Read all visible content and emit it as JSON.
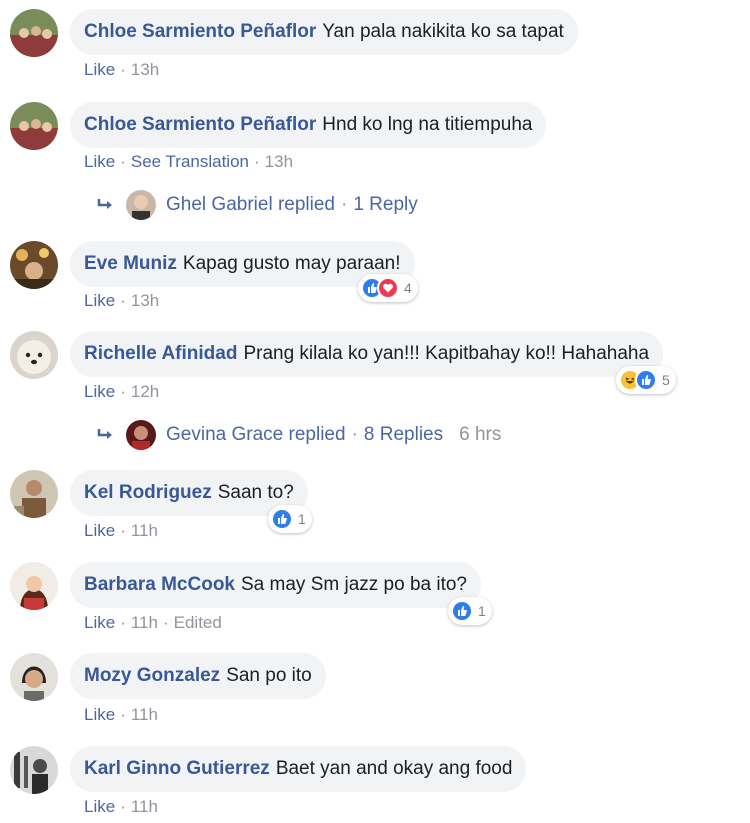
{
  "comments": [
    {
      "author": "Chloe Sarmiento Peñaflor",
      "text": "Yan pala nakikita ko sa tapat",
      "actions": {
        "like": "Like",
        "time": "13h"
      }
    },
    {
      "author": "Chloe Sarmiento Peñaflor",
      "text": "Hnd ko lng na titiempuha",
      "actions": {
        "like": "Like",
        "translate": "See Translation",
        "time": "13h"
      },
      "reply": {
        "name": "Ghel Gabriel",
        "replied": "replied",
        "count": "1 Reply"
      }
    },
    {
      "author": "Eve Muniz",
      "text": "Kapag gusto may paraan!",
      "actions": {
        "like": "Like",
        "time": "13h"
      },
      "reactions": {
        "count": "4",
        "types": [
          "like-icon",
          "love-icon"
        ]
      }
    },
    {
      "author": "Richelle Afinidad",
      "text": "Prang kilala ko yan!!! Kapitbahay ko!! Hahahaha",
      "actions": {
        "like": "Like",
        "time": "12h"
      },
      "reactions": {
        "count": "5",
        "types": [
          "haha-icon",
          "like-icon"
        ]
      },
      "reply": {
        "name": "Gevina Grace",
        "replied": "replied",
        "count": "8 Replies",
        "time": "6 hrs"
      }
    },
    {
      "author": "Kel Rodriguez",
      "text": "Saan to?",
      "actions": {
        "like": "Like",
        "time": "11h"
      },
      "reactions": {
        "count": "1",
        "types": [
          "like-icon"
        ]
      }
    },
    {
      "author": "Barbara McCook",
      "text": "Sa may Sm jazz po ba ito?",
      "actions": {
        "like": "Like",
        "time": "11h",
        "edited": "Edited"
      },
      "reactions": {
        "count": "1",
        "types": [
          "like-icon"
        ]
      }
    },
    {
      "author": "Mozy Gonzalez",
      "text": "San po ito",
      "actions": {
        "like": "Like",
        "time": "11h"
      }
    },
    {
      "author": "Karl Ginno Gutierrez",
      "text": "Baet yan and okay ang food",
      "actions": {
        "like": "Like",
        "time": "11h"
      }
    }
  ],
  "colors": {
    "author": "#385898",
    "link": "#4b67a1",
    "bubble": "#f2f3f5",
    "like": "#2f7dea",
    "love": "#ef3a4e",
    "haha": "#f7c23a"
  }
}
